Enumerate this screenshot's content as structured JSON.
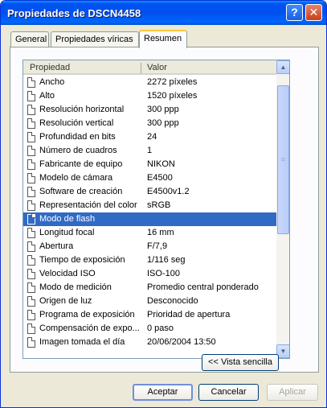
{
  "window": {
    "title": "Propiedades de DSCN4458",
    "help_label": "?",
    "close_label": "✕"
  },
  "tabs": [
    {
      "label": "General",
      "active": false
    },
    {
      "label": "Propiedades víricas",
      "active": false
    },
    {
      "label": "Resumen",
      "active": true
    }
  ],
  "list": {
    "headers": {
      "property": "Propiedad",
      "value": "Valor"
    },
    "selected_index": 10,
    "rows": [
      {
        "property": "Ancho",
        "value": "2272 píxeles"
      },
      {
        "property": "Alto",
        "value": "1520 píxeles"
      },
      {
        "property": "Resolución horizontal",
        "value": "300 ppp"
      },
      {
        "property": "Resolución vertical",
        "value": "300 ppp"
      },
      {
        "property": "Profundidad en bits",
        "value": "24"
      },
      {
        "property": "Número de cuadros",
        "value": "1"
      },
      {
        "property": "Fabricante de equipo",
        "value": "NIKON"
      },
      {
        "property": "Modelo de cámara",
        "value": "E4500"
      },
      {
        "property": "Software de creación",
        "value": "E4500v1.2"
      },
      {
        "property": "Representación del color",
        "value": "sRGB"
      },
      {
        "property": "Modo de flash",
        "value": ""
      },
      {
        "property": "Longitud focal",
        "value": "16 mm"
      },
      {
        "property": "Abertura",
        "value": "F/7,9"
      },
      {
        "property": "Tiempo de exposición",
        "value": "1/116 seg"
      },
      {
        "property": "Velocidad ISO",
        "value": "ISO-100"
      },
      {
        "property": "Modo de medición",
        "value": "Promedio central ponderado"
      },
      {
        "property": "Origen de luz",
        "value": "Desconocido"
      },
      {
        "property": "Programa de exposición",
        "value": "Prioridad de apertura"
      },
      {
        "property": "Compensación de expo...",
        "value": "0 paso"
      },
      {
        "property": "Imagen tomada el día",
        "value": "20/06/2004 13:50"
      }
    ]
  },
  "buttons": {
    "simple_view": "<< Vista sencilla",
    "ok": "Aceptar",
    "cancel": "Cancelar",
    "apply": "Aplicar"
  },
  "colors": {
    "titlebar": "#0053ee",
    "selection": "#316ac5",
    "tab_highlight": "#ffc83c"
  }
}
